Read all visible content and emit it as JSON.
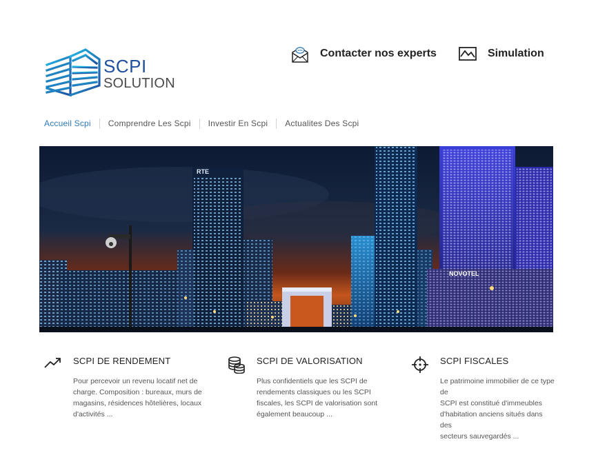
{
  "brand": {
    "line1": "SCPI",
    "line2": "SOLUTION",
    "primary_color": "#1f4f9e",
    "accent_color": "#1aa3d6"
  },
  "header": {
    "contact_label": "Contacter nos experts",
    "contact_icon": "envelope-chat-icon",
    "simulation_label": "Simulation",
    "simulation_icon": "chart-frame-icon"
  },
  "nav": {
    "active_color": "#2f79b9",
    "items": [
      {
        "label": "Accueil Scpi",
        "active": true
      },
      {
        "label": "Comprendre Les Scpi"
      },
      {
        "label": "Investir En Scpi"
      },
      {
        "label": "Actualites Des Scpi"
      }
    ]
  },
  "features": [
    {
      "icon": "trending-up-icon",
      "title": "SCPI DE RENDEMENT",
      "text": "Pour percevoir un revenu locatif net de\ncharge. Composition : bureaux, murs de\nmagasins, résidences hôtelières, locaux\nd'activités ..."
    },
    {
      "icon": "coins-stack-icon",
      "title": "SCPI DE VALORISATION",
      "text": "Plus confidentiels que les SCPI de\nrendements classiques ou les SCPI\nfiscales, les SCPI de valorisation sont\négalement beaucoup ..."
    },
    {
      "icon": "crosshair-icon",
      "title": "SCPI FISCALES",
      "text": "Le patrimoine immobilier de ce type de\nSCPI est constitué d'immeubles\nd'habitation anciens situés dans des\nsecteurs sauvegardés ..."
    }
  ],
  "hero": {
    "signs": [
      "RTE",
      "NOVOTEL"
    ]
  }
}
